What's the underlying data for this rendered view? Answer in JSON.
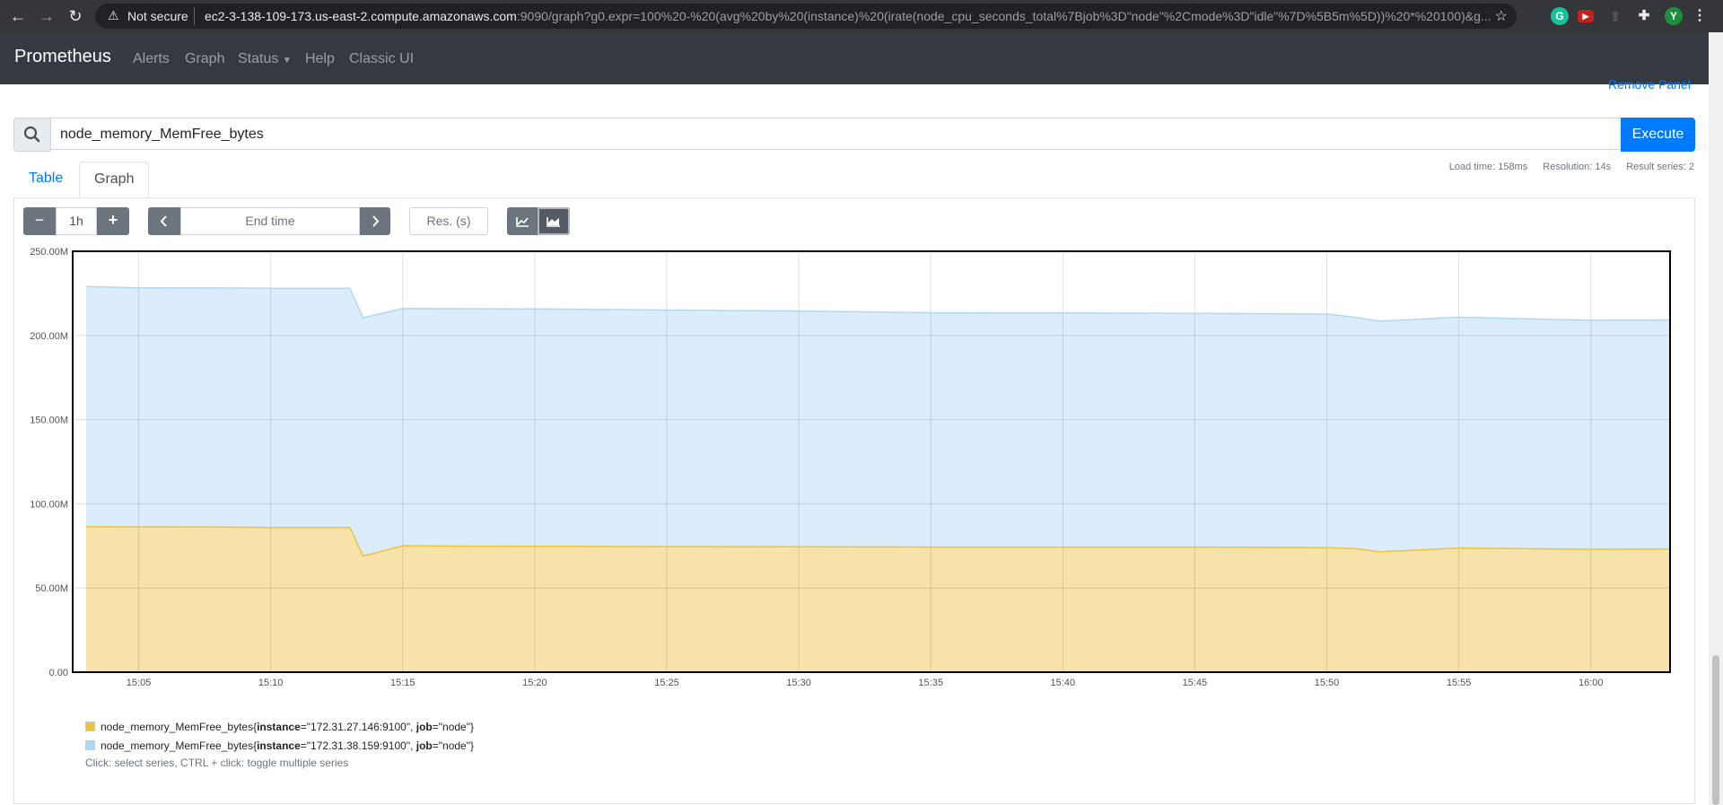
{
  "browser": {
    "security_label": "Not secure",
    "url_host": "ec2-3-138-109-173.us-east-2.compute.amazonaws.com",
    "url_rest": ":9090/graph?g0.expr=100%20-%20(avg%20by%20(instance)%20(irate(node_cpu_seconds_total%7Bjob%3D\"node\"%2Cmode%3D\"idle\"%7D%5B5m%5D))%20*%20100)&g...",
    "profile_initial": "Y"
  },
  "nav": {
    "brand": "Prometheus",
    "links": [
      "Alerts",
      "Graph",
      "Status",
      "Help",
      "Classic UI"
    ]
  },
  "panel": {
    "remove_label": "Remove Panel",
    "expression": "node_memory_MemFree_bytes",
    "execute_label": "Execute",
    "tabs": [
      "Table",
      "Graph"
    ],
    "active_tab": "Graph",
    "stats": {
      "load_time": "Load time: 158ms",
      "resolution": "Resolution: 14s",
      "result_series": "Result series: 2"
    }
  },
  "controls": {
    "range": "1h",
    "minus": "−",
    "plus": "+",
    "end_time_placeholder": "End time",
    "resolution_placeholder": "Res. (s)"
  },
  "chart_data": {
    "type": "area",
    "stacked": true,
    "x_ticks": [
      "15:05",
      "15:10",
      "15:15",
      "15:20",
      "15:25",
      "15:30",
      "15:35",
      "15:40",
      "15:45",
      "15:50",
      "15:55",
      "16:00"
    ],
    "x": [
      "15:03",
      "15:05",
      "15:08",
      "15:10",
      "15:12",
      "15:13",
      "15:13:30",
      "15:15",
      "15:20",
      "15:25",
      "15:30",
      "15:35",
      "15:40",
      "15:45",
      "15:50",
      "15:51",
      "15:52",
      "15:55",
      "16:00",
      "16:03"
    ],
    "y_ticks": [
      "0.00",
      "50.00M",
      "100.00M",
      "150.00M",
      "200.00M",
      "250.00M"
    ],
    "ylim": [
      0,
      250
    ],
    "y_unit": "M",
    "grid": true,
    "series": [
      {
        "name": "node_memory_MemFree_bytes{instance=\"172.31.27.146:9100\", job=\"node\"}",
        "color": "#edc240",
        "values": [
          86.5,
          86.3,
          86.2,
          86.0,
          86.0,
          86.0,
          69.0,
          75.0,
          74.8,
          74.6,
          74.5,
          74.3,
          74.3,
          74.3,
          74.0,
          73.5,
          71.5,
          73.8,
          73.0,
          73.2
        ]
      },
      {
        "name": "node_memory_MemFree_bytes{instance=\"172.31.38.159:9100\", job=\"node\"}",
        "color": "#afd8f8",
        "values": [
          142.5,
          142.0,
          142.0,
          142.0,
          142.0,
          142.0,
          141.5,
          141.0,
          141.0,
          140.5,
          140.0,
          139.2,
          139.0,
          138.8,
          138.7,
          137.5,
          137.0,
          137.0,
          136.0,
          136.0
        ]
      }
    ],
    "legend_position": "bottom-left"
  },
  "legend": {
    "items": [
      {
        "metric": "node_memory_MemFree_bytes{",
        "k1": "instance",
        "v1": "=\"172.31.27.146:9100\", ",
        "k2": "job",
        "v2": "=\"node\"}",
        "color": "#edc240"
      },
      {
        "metric": "node_memory_MemFree_bytes{",
        "k1": "instance",
        "v1": "=\"172.31.38.159:9100\", ",
        "k2": "job",
        "v2": "=\"node\"}",
        "color": "#afd8f8"
      }
    ],
    "hint": "Click: select series, CTRL + click: toggle multiple series"
  }
}
